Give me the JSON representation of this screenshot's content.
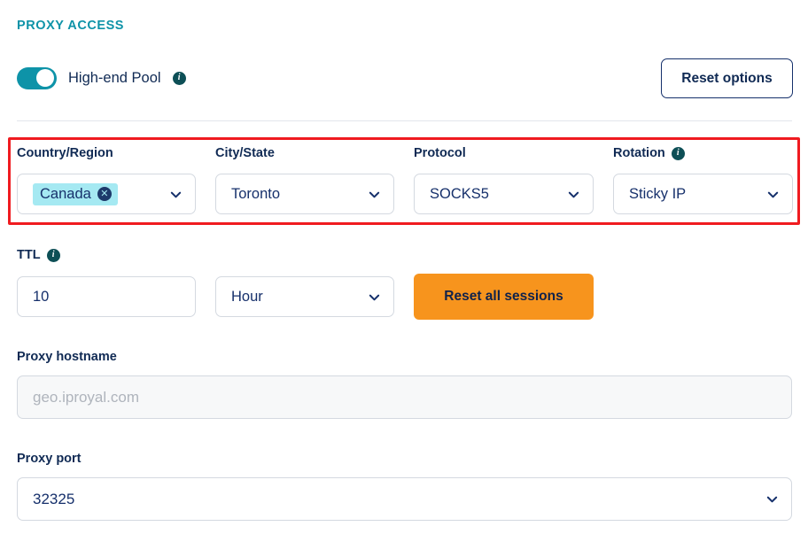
{
  "section": {
    "title": "PROXY ACCESS"
  },
  "pool_toggle": {
    "label": "High-end Pool",
    "state": "on",
    "info_icon": "info-icon",
    "accent_color": "#0E93A8"
  },
  "reset_options": {
    "label": "Reset options"
  },
  "fields": {
    "country": {
      "label": "Country/Region",
      "chip_value": "Canada",
      "remove_glyph": "✕",
      "chip_bg": "#A5E9F2"
    },
    "city": {
      "label": "City/State",
      "value": "Toronto"
    },
    "protocol": {
      "label": "Protocol",
      "value": "SOCKS5"
    },
    "rotation": {
      "label": "Rotation",
      "value": "Sticky IP",
      "info_icon": "info-icon"
    },
    "ttl": {
      "label": "TTL",
      "info_icon": "info-icon",
      "value": "10",
      "unit": "Hour"
    },
    "hostname": {
      "label": "Proxy hostname",
      "placeholder": "geo.iproyal.com",
      "value": ""
    },
    "port": {
      "label": "Proxy port",
      "value": "32325"
    }
  },
  "reset_sessions": {
    "label": "Reset all sessions",
    "bg_color": "#F7941D"
  },
  "highlight": {
    "color": "#F01B20"
  }
}
